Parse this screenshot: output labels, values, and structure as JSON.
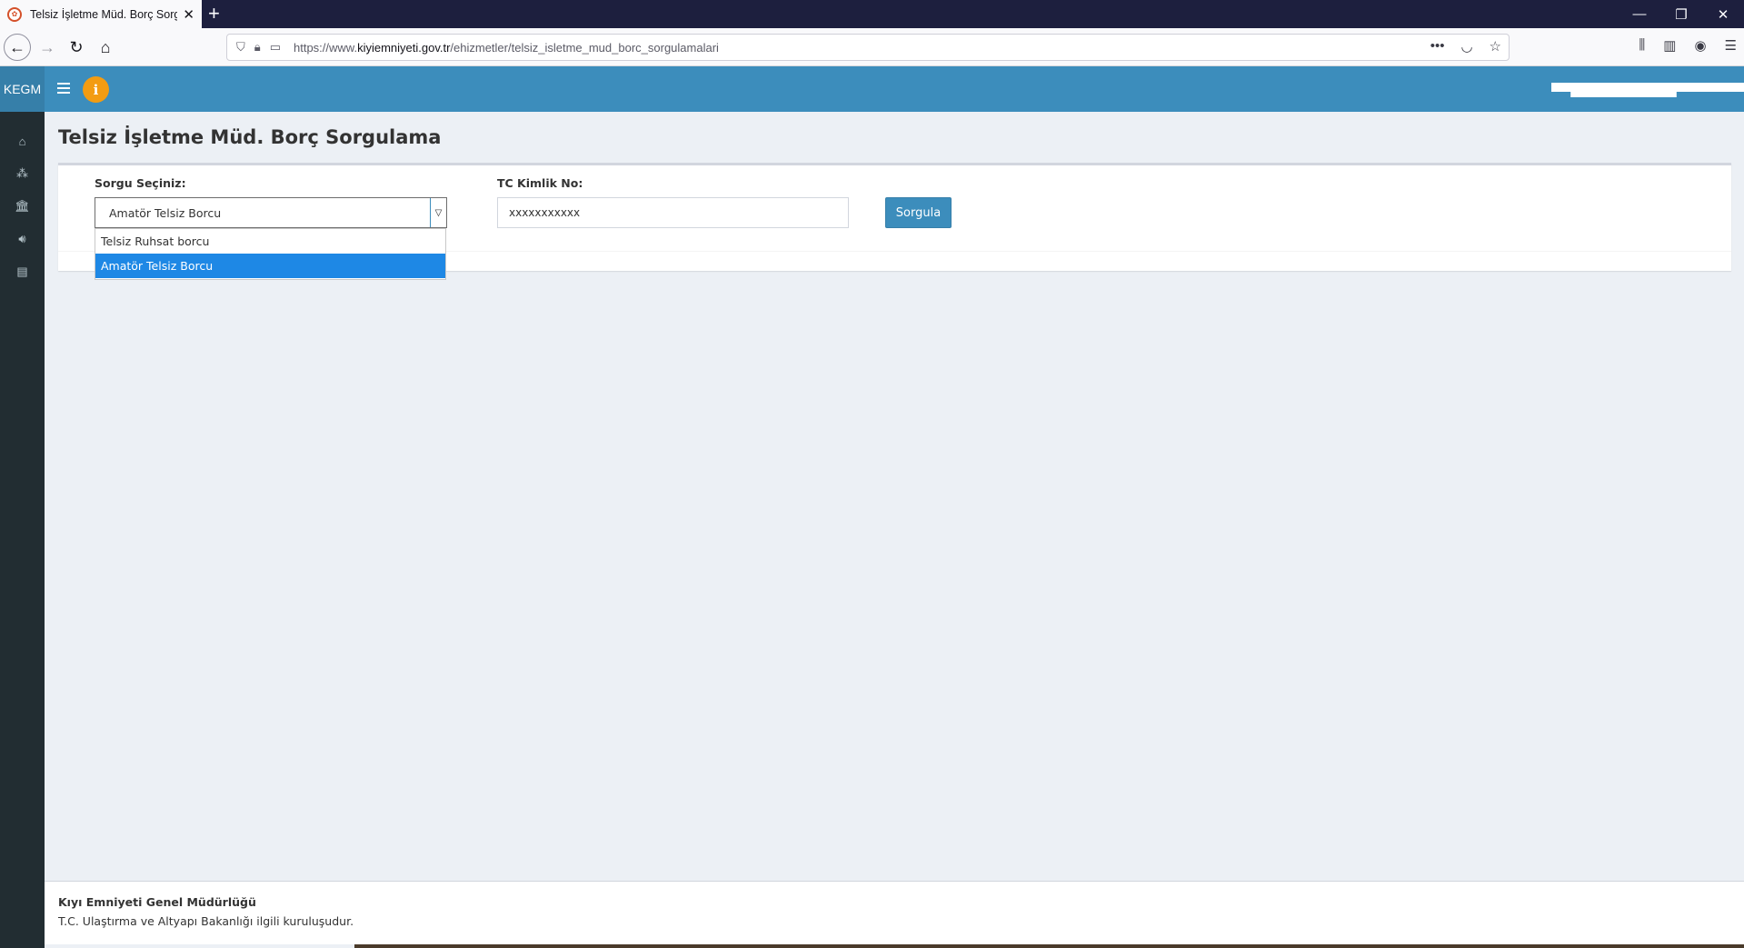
{
  "browser": {
    "tab_title": "Telsiz İşletme Müd. Borç Sorgulama",
    "url_prefix": "https://www.",
    "url_domain": "kiyiemniyeti.gov.tr",
    "url_path": "/ehizmetler/telsiz_isletme_mud_borc_sorgulamalari",
    "close_glyph": "✕",
    "new_tab_glyph": "+"
  },
  "header": {
    "brand": "KEGM",
    "info_glyph": "i",
    "accent_color": "#3c8dbc",
    "info_color": "#f39c12"
  },
  "sidebar": {
    "items": [
      {
        "icon": "home-icon"
      },
      {
        "icon": "cubes-icon"
      },
      {
        "icon": "bank-icon"
      },
      {
        "icon": "volume-icon"
      },
      {
        "icon": "id-card-icon"
      }
    ]
  },
  "page": {
    "title": "Telsiz İşletme Müd. Borç Sorgulama"
  },
  "form": {
    "query_label": "Sorgu Seçiniz:",
    "query_selected": "Amatör Telsiz Borcu",
    "query_options": [
      "Telsiz Ruhsat borcu",
      "Amatör Telsiz Borcu"
    ],
    "tc_label": "TC Kimlik No:",
    "tc_value": "xxxxxxxxxxx",
    "submit_label": "Sorgula"
  },
  "footer": {
    "org": "Kıyı Emniyeti Genel Müdürlüğü",
    "note": "T.C. Ulaştırma ve Altyapı Bakanlığı ilgili kuruluşudur."
  }
}
